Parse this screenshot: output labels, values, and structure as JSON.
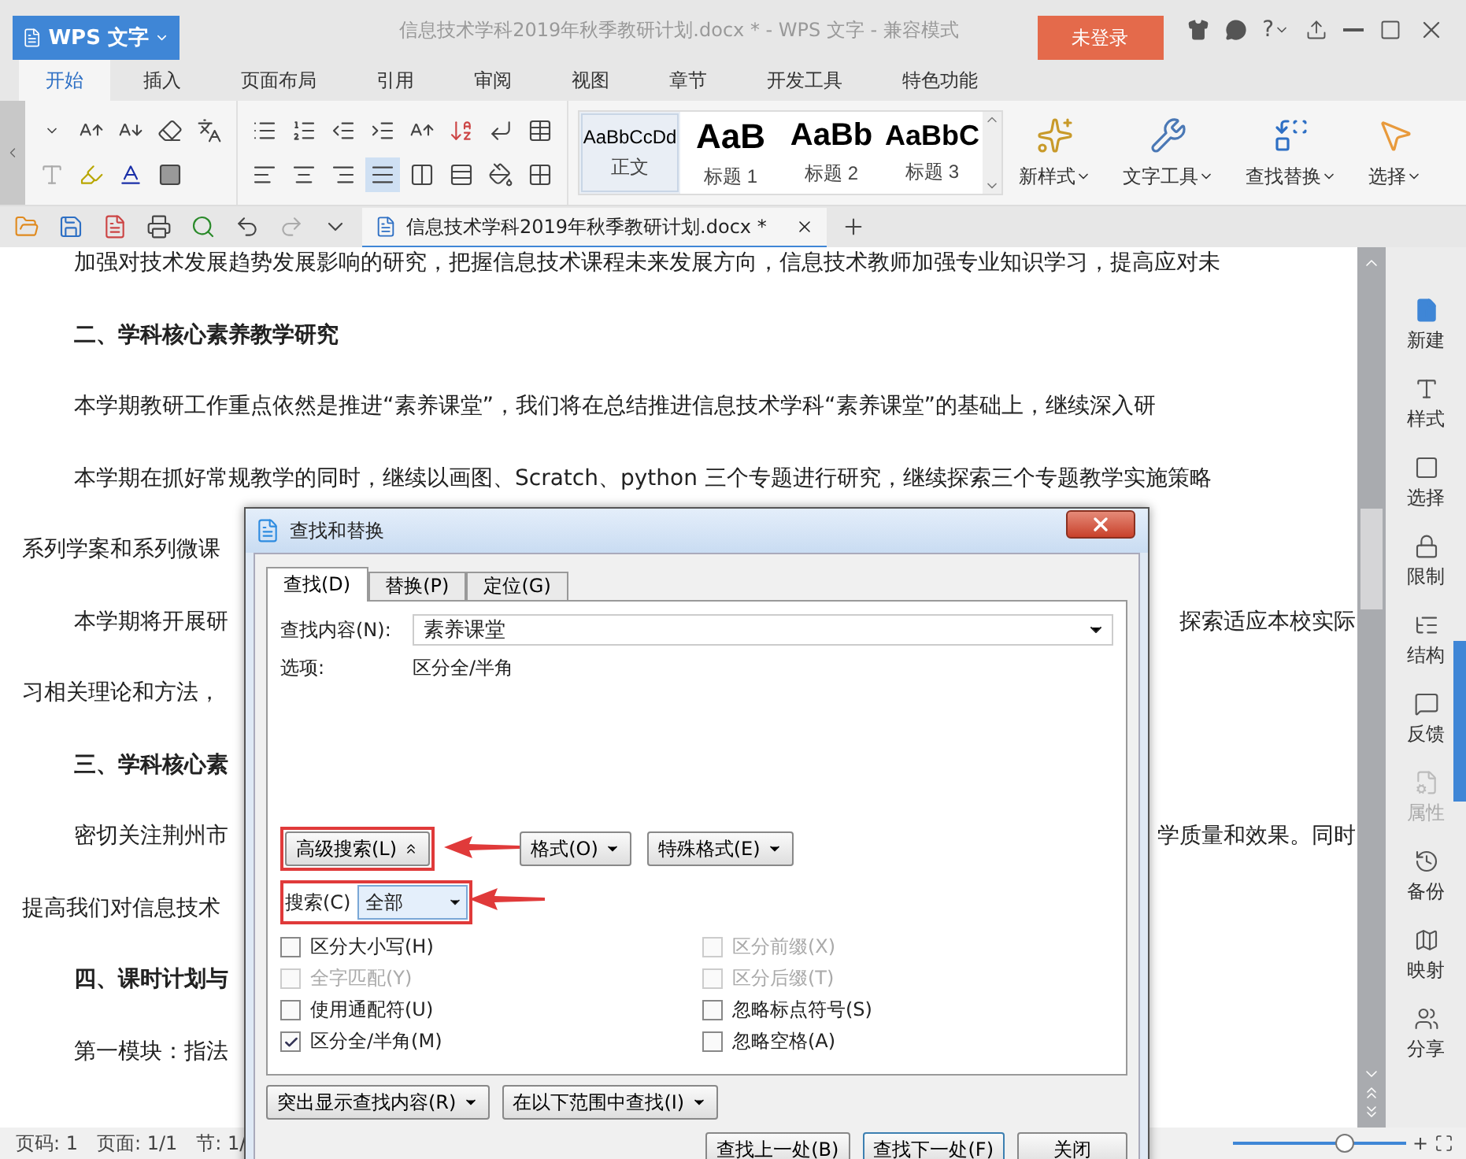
{
  "app_button": {
    "label": "WPS 文字"
  },
  "window": {
    "title": "信息技术学科2019年秋季教研计划.docx * - WPS 文字 - 兼容模式",
    "login": "未登录",
    "help": "?"
  },
  "ribbon_tabs": [
    {
      "label": "开始",
      "selected": true
    },
    {
      "label": "插入",
      "selected": false
    },
    {
      "label": "页面布局",
      "selected": false
    },
    {
      "label": "引用",
      "selected": false
    },
    {
      "label": "审阅",
      "selected": false
    },
    {
      "label": "视图",
      "selected": false
    },
    {
      "label": "章节",
      "selected": false
    },
    {
      "label": "开发工具",
      "selected": false
    },
    {
      "label": "特色功能",
      "selected": false
    }
  ],
  "alignment_buttons": [
    {
      "selected": false
    },
    {
      "selected": false
    },
    {
      "selected": false
    },
    {
      "selected": true
    },
    {
      "selected": false
    }
  ],
  "styles": [
    {
      "sample": "AaBbCcDd",
      "label": "正文",
      "selected": true
    },
    {
      "sample": "AaB",
      "label": "标题 1",
      "selected": false
    },
    {
      "sample": "AaBb",
      "label": "标题 2",
      "selected": false
    },
    {
      "sample": "AaBbC",
      "label": "标题 3",
      "selected": false
    }
  ],
  "big_buttons": [
    {
      "label": "新样式"
    },
    {
      "label": "文字工具"
    },
    {
      "label": "查找替换"
    },
    {
      "label": "选择"
    }
  ],
  "document_tab": {
    "label": "信息技术学科2019年秋季教研计划.docx *"
  },
  "paragraphs": [
    {
      "kind": "first",
      "left": "加强对技术发展趋势发展影响的研究，把握信息技术课程未来发展方向，信息技术教师加强专业知识学习，提高应对未"
    },
    {
      "kind": "heading",
      "left": "二、学科核心素养教学研究"
    },
    {
      "kind": "first",
      "left": "本学期教研工作重点依然是推进“素养课堂”，我们将在总结推进信息技术学科“素养课堂”的基础上，继续深入研"
    },
    {
      "kind": "first",
      "left": "本学期在抓好常规教学的同时，继续以画图、Scratch、python 三个专题进行研究，继续探索三个专题教学实施策略"
    },
    {
      "kind": "cont",
      "left": "系列学案和系列微课"
    },
    {
      "kind": "first",
      "left": "本学期将开展研",
      "right": "探索适应本校实际"
    },
    {
      "kind": "cont",
      "left": "习相关理论和方法，"
    },
    {
      "kind": "heading",
      "left": "三、学科核心素"
    },
    {
      "kind": "first",
      "left": "密切关注荆州市",
      "right": "学质量和效果。同时"
    },
    {
      "kind": "cont",
      "left": "提高我们对信息技术"
    },
    {
      "kind": "heading",
      "left": "四、课时计划与"
    },
    {
      "kind": "first",
      "left": "第一模块：指法"
    }
  ],
  "sidebar": {
    "items": [
      {
        "label": "新建",
        "disabled": false
      },
      {
        "label": "样式",
        "disabled": false
      },
      {
        "label": "选择",
        "disabled": false
      },
      {
        "label": "限制",
        "disabled": false
      },
      {
        "label": "结构",
        "disabled": false
      },
      {
        "label": "反馈",
        "disabled": false
      },
      {
        "label": "属性",
        "disabled": true
      },
      {
        "label": "备份",
        "disabled": false
      },
      {
        "label": "映射",
        "disabled": false
      },
      {
        "label": "分享",
        "disabled": false
      }
    ]
  },
  "status_bar": {
    "items": [
      "页码: 1",
      "页面: 1/1",
      "节: 1/"
    ],
    "zoom": {
      "level": 0.66,
      "plus": "+"
    }
  },
  "dialog": {
    "title": "查找和替换",
    "tabs": [
      {
        "label": "查找(D)",
        "selected": true
      },
      {
        "label": "替换(P)",
        "selected": false
      },
      {
        "label": "定位(G)",
        "selected": false
      }
    ],
    "find_label": "查找内容(N):",
    "find_value": "素养课堂",
    "options_label": "选项:",
    "options_value": "区分全/半角",
    "option_buttons": [
      {
        "label": "高级搜索(L)",
        "kind": "toggle"
      },
      {
        "label": "格式(O)",
        "kind": "menu"
      },
      {
        "label": "特殊格式(E)",
        "kind": "menu"
      }
    ],
    "search_label": "搜索(C)",
    "search_value": "全部",
    "checkboxes_left": [
      {
        "label": "区分大小写(H)",
        "checked": false,
        "disabled": false
      },
      {
        "label": "全字匹配(Y)",
        "checked": false,
        "disabled": true
      },
      {
        "label": "使用通配符(U)",
        "checked": false,
        "disabled": false
      },
      {
        "label": "区分全/半角(M)",
        "checked": true,
        "disabled": false
      }
    ],
    "checkboxes_right": [
      {
        "label": "区分前缀(X)",
        "checked": false,
        "disabled": true
      },
      {
        "label": "区分后缀(T)",
        "checked": false,
        "disabled": true
      },
      {
        "label": "忽略标点符号(S)",
        "checked": false,
        "disabled": false
      },
      {
        "label": "忽略空格(A)",
        "checked": false,
        "disabled": false
      }
    ],
    "menu_buttons": [
      {
        "label": "突出显示查找内容(R)"
      },
      {
        "label": "在以下范围中查找(I)"
      }
    ],
    "buttons": [
      {
        "label": "查找上一处(B)",
        "default": false
      },
      {
        "label": "查找下一处(F)",
        "default": true
      },
      {
        "label": "关闭",
        "default": false
      }
    ]
  }
}
